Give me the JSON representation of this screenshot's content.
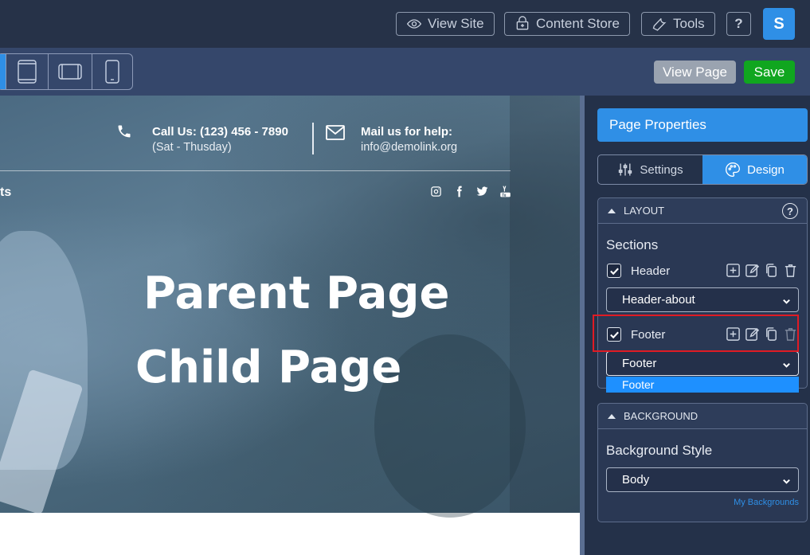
{
  "topbar": {
    "view_site": "View Site",
    "content_store": "Content Store",
    "tools": "Tools",
    "help": "?",
    "avatar": "S"
  },
  "subbar": {
    "view_page": "View Page",
    "save": "Save"
  },
  "preview": {
    "call_title": "Call Us: (123) 456 - 7890",
    "call_hours": "(Sat - Thusday)",
    "mail_title": "Mail us for help:",
    "mail_address": "info@demolink.org",
    "nav_fragment": "ts",
    "title_parent": "Parent Page",
    "title_child": "Child Page"
  },
  "panel": {
    "title": "Page Properties",
    "tabs": [
      "Settings",
      "Design"
    ],
    "active_tab": "Design",
    "layout": {
      "heading": "LAYOUT",
      "help": "?",
      "sections_label": "Sections",
      "header": {
        "label": "Header",
        "checked": true,
        "selected": "Header-about"
      },
      "footer": {
        "label": "Footer",
        "checked": true,
        "selected": "Footer",
        "options": [
          "Footer"
        ]
      }
    },
    "background": {
      "heading": "BACKGROUND",
      "style_label": "Background Style",
      "selected": "Body",
      "link": "My Backgrounds"
    }
  },
  "colors": {
    "accent": "#2f8fe6",
    "save": "#10a61f",
    "highlight": "#e01b24"
  }
}
